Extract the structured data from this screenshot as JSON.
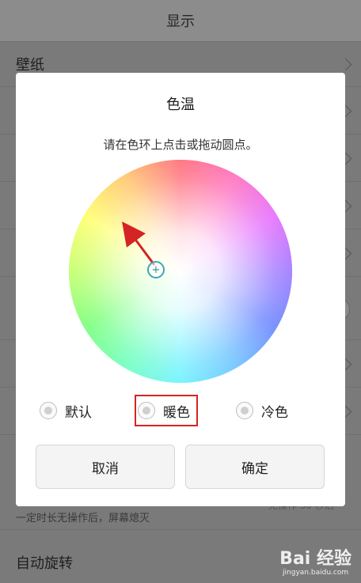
{
  "background": {
    "title": "显示",
    "wallpaper_label": "壁纸",
    "sleep_sub": "一定时长无操作后，屏幕熄灭",
    "sleep_value_partial": "无操作 30 秒后",
    "auto_rotate_label": "自动旋转"
  },
  "dialog": {
    "title": "色温",
    "hint": "请在色环上点击或拖动圆点。",
    "options": [
      {
        "label": "默认"
      },
      {
        "label": "暖色"
      },
      {
        "label": "冷色"
      }
    ],
    "highlighted_option": "暖色",
    "cancel_label": "取消",
    "confirm_label": "确定"
  },
  "watermark": {
    "text": "Bai 经验",
    "sub": "jingyan.baidu.com"
  },
  "colors": {
    "annotation_red": "#d42424",
    "selector_teal": "#3aa8b8"
  },
  "icons": {
    "selector": "plus-icon",
    "row_chevron": "chevron-right-icon"
  }
}
